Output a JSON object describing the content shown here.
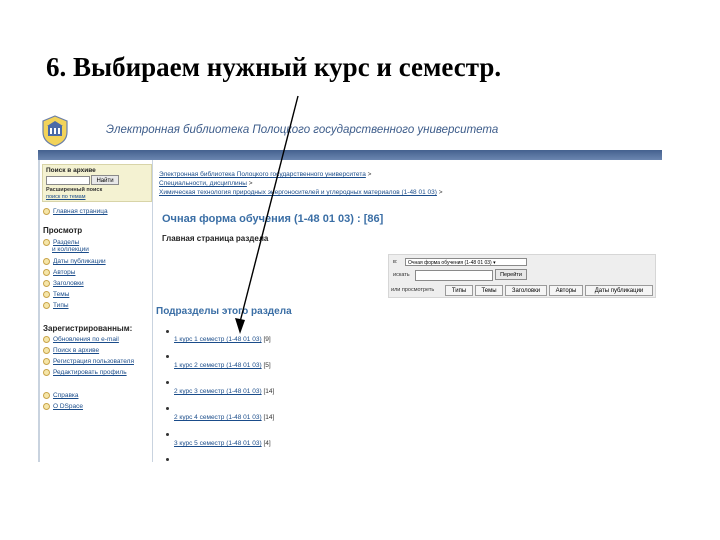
{
  "slide": {
    "title": "6. Выбираем нужный курс и семестр."
  },
  "header": {
    "site_title": "Электронная библиотека Полоцкого государственного университета"
  },
  "sidebar": {
    "search_title": "Поиск в архиве",
    "find_label": "Найти",
    "advanced_search": "Расширенный поиск",
    "advanced_search_link": "поиск по темам",
    "home": "Главная страница",
    "browse_heading": "Просмотр",
    "browse_items": [
      "Разделы",
      "и коллекции",
      "Даты публикации",
      "Авторы",
      "Заголовки",
      "Темы",
      "Типы"
    ],
    "registered_heading": "Зарегистрированным:",
    "registered_items": [
      "Обновления по e-mail",
      "Поиск в архиве",
      "Регистрация пользователя",
      "Редактировать профиль"
    ],
    "extra_items": [
      "Справка",
      "О DSpace"
    ]
  },
  "main": {
    "breadcrumbs": [
      "Электронная библиотека Полоцкого государственного университета",
      "Специальности, дисциплины",
      "Химическая технология природных энергоносителей и углеродных материалов (1-48 01 03)"
    ],
    "breadcrumb_sep": ">",
    "section_title": "Очная форма обучения (1-48 01 03) : [86]",
    "section_subtitle": "Главная страница раздела",
    "filter": {
      "in_label": "в:",
      "select_value": "Очная форма обучения (1-48 01 03)",
      "for_label": "искать",
      "search_button": "Перейти",
      "browse_label": "или просмотреть",
      "tabs": [
        "Типы",
        "Темы",
        "Заголовки",
        "Авторы",
        "Даты публикации"
      ]
    },
    "subsections_heading": "Подразделы этого раздела",
    "subsections": [
      {
        "label": "1 курс 1 семестр (1-48 01 03)",
        "count": "[9]"
      },
      {
        "label": "1 курс 2 семестр (1-48 01 03)",
        "count": "[5]"
      },
      {
        "label": "2 курс 3 семестр (1-48 01 03)",
        "count": "[14]"
      },
      {
        "label": "2 курс 4 семестр (1-48 01 03)",
        "count": "[14]"
      },
      {
        "label": "3 курс 5 семестр (1-48 01 03)",
        "count": "[4]"
      }
    ]
  },
  "colors": {
    "header_bar": "#44618f",
    "link": "#1a4c8a",
    "section_title": "#3a6ea5",
    "arrow": "#000000"
  }
}
